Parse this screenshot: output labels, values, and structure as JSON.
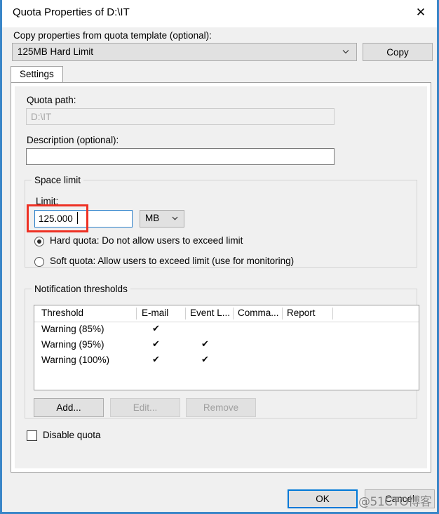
{
  "window": {
    "title": "Quota Properties of D:\\IT",
    "close_icon": "close-icon",
    "accent_color": "#3a86c8"
  },
  "template_row": {
    "label": "Copy properties from quota template (optional):",
    "selected": "125MB Hard Limit",
    "chevron_icon": "chevron-down-icon",
    "copy_button": "Copy"
  },
  "tabs": [
    {
      "label": "Settings",
      "selected": true
    }
  ],
  "settings": {
    "quota_path_label": "Quota path:",
    "quota_path_value": "D:\\IT",
    "description_label": "Description (optional):",
    "description_value": "",
    "space_limit": {
      "group_label": "Space limit",
      "limit_label": "Limit:",
      "limit_value": "125.000",
      "unit_value": "MB",
      "unit_chevron_icon": "chevron-down-icon",
      "highlight_color": "#ee3124",
      "options": [
        {
          "label": "Hard quota: Do not allow users to exceed limit",
          "selected": true
        },
        {
          "label": "Soft quota: Allow users to exceed limit (use for monitoring)",
          "selected": false
        }
      ]
    },
    "thresholds": {
      "group_label": "Notification thresholds",
      "columns": [
        "Threshold",
        "E-mail",
        "Event L...",
        "Comma...",
        "Report"
      ],
      "rows": [
        {
          "threshold": "Warning (85%)",
          "email": "✔",
          "event_log": "",
          "command": "",
          "report": ""
        },
        {
          "threshold": "Warning (95%)",
          "email": "✔",
          "event_log": "✔",
          "command": "",
          "report": ""
        },
        {
          "threshold": "Warning (100%)",
          "email": "✔",
          "event_log": "✔",
          "command": "",
          "report": ""
        }
      ],
      "buttons": {
        "add": "Add...",
        "edit": "Edit...",
        "remove": "Remove"
      }
    },
    "disable_quota": {
      "label": "Disable quota",
      "checked": false
    }
  },
  "footer": {
    "ok": "OK",
    "cancel": "Cancel",
    "watermark": "@51CTO博客"
  }
}
